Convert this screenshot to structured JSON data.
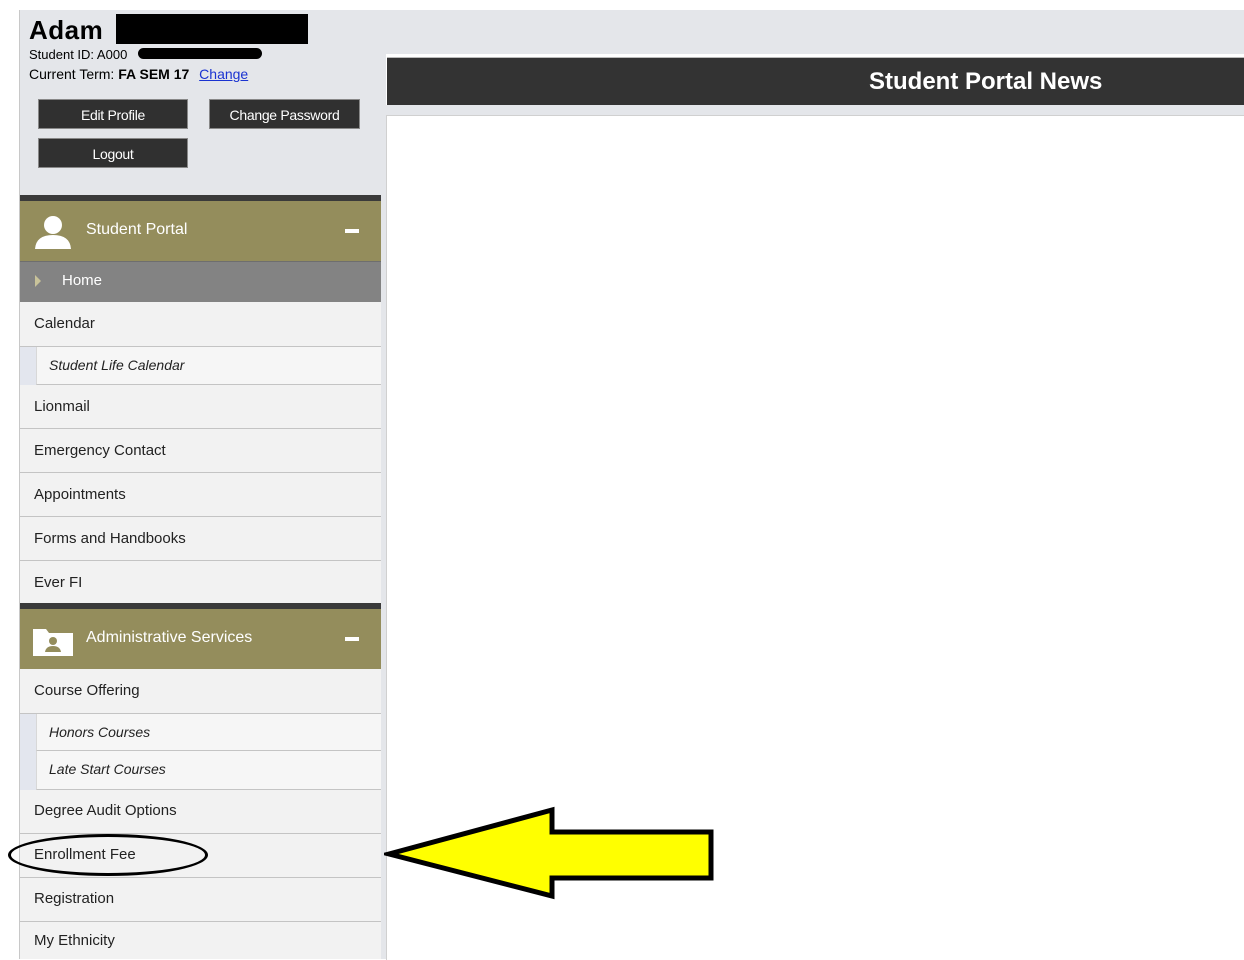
{
  "profile": {
    "name": "Adam",
    "student_id_label": "Student ID: A000",
    "term_label": "Current Term:",
    "term_value": "FA SEM 17",
    "change_link": "Change",
    "buttons": {
      "edit_profile": "Edit Profile",
      "change_password": "Change Password",
      "logout": "Logout"
    }
  },
  "sidebar": {
    "student_portal": {
      "title": "Student Portal",
      "icon": "user-icon",
      "active_item": "Home",
      "items": [
        {
          "label": "Calendar",
          "type": "item"
        },
        {
          "label": "Student Life Calendar",
          "type": "sub"
        },
        {
          "label": "Lionmail",
          "type": "item"
        },
        {
          "label": "Emergency Contact",
          "type": "item"
        },
        {
          "label": "Appointments",
          "type": "item"
        },
        {
          "label": "Forms and Handbooks",
          "type": "item"
        },
        {
          "label": "Ever FI",
          "type": "item"
        }
      ]
    },
    "admin_services": {
      "title": "Administrative Services",
      "icon": "folder-user-icon",
      "items": [
        {
          "label": "Course Offering",
          "type": "item"
        },
        {
          "label": "Honors Courses",
          "type": "sub"
        },
        {
          "label": "Late Start Courses",
          "type": "sub"
        },
        {
          "label": "Degree Audit Options",
          "type": "item"
        },
        {
          "label": "Enrollment Fee",
          "type": "item"
        },
        {
          "label": "Registration",
          "type": "item"
        },
        {
          "label": "My Ethnicity",
          "type": "item"
        }
      ]
    }
  },
  "main": {
    "news_title": "Student Portal News"
  },
  "colors": {
    "section_header": "#948d5c",
    "dark_bar": "#333333",
    "active_item": "#838383",
    "link": "#1a33d1",
    "arrow": "#ffff00"
  }
}
